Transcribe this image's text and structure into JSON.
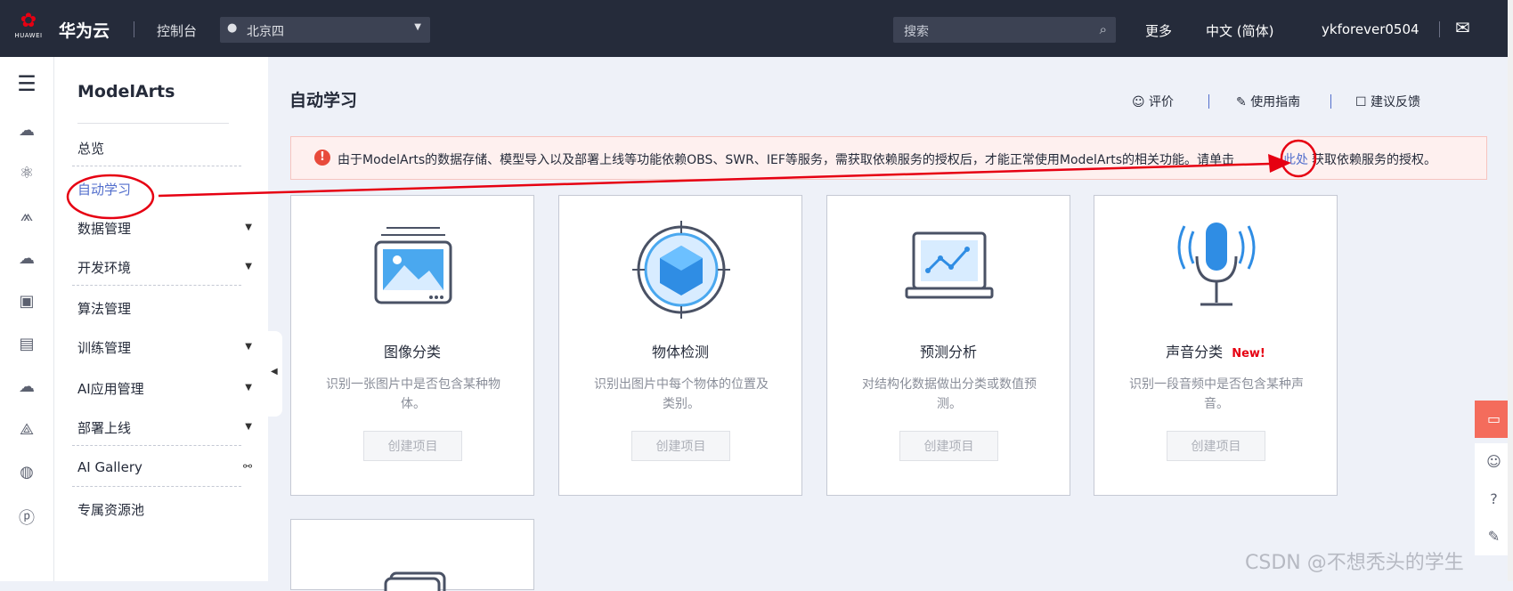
{
  "topbar": {
    "logo_text": "HUAWEI",
    "brand": "华为云",
    "console": "控制台",
    "region": "北京四",
    "search_placeholder": "搜索",
    "more": "更多",
    "language": "中文 (简体)",
    "username": "ykforever0504"
  },
  "sidebar": {
    "title": "ModelArts",
    "items": [
      {
        "label": "总览"
      },
      {
        "label": "自动学习"
      },
      {
        "label": "数据管理"
      },
      {
        "label": "开发环境"
      },
      {
        "label": "算法管理"
      },
      {
        "label": "训练管理"
      },
      {
        "label": "AI应用管理"
      },
      {
        "label": "部署上线"
      },
      {
        "label": "AI Gallery"
      },
      {
        "label": "专属资源池"
      }
    ]
  },
  "header": {
    "title": "自动学习",
    "rate": "评价",
    "guide": "使用指南",
    "feedback": "建议反馈"
  },
  "alert": {
    "text_before": "由于ModelArts的数据存储、模型导入以及部署上线等功能依赖OBS、SWR、IEF等服务，需获取依赖服务的授权后，才能正常使用ModelArts的相关功能。请单击",
    "link": "此处",
    "text_after": "获取依赖服务的授权。"
  },
  "cards": [
    {
      "title": "图像分类",
      "desc": "识别一张图片中是否包含某种物体。",
      "button": "创建项目",
      "badge": ""
    },
    {
      "title": "物体检测",
      "desc": "识别出图片中每个物体的位置及类别。",
      "button": "创建项目",
      "badge": ""
    },
    {
      "title": "预测分析",
      "desc": "对结构化数据做出分类或数值预测。",
      "button": "创建项目",
      "badge": ""
    },
    {
      "title": "声音分类",
      "desc": "识别一段音频中是否包含某种声音。",
      "button": "创建项目",
      "badge": "New!"
    }
  ],
  "watermark": "CSDN @不想秃头的学生",
  "colors": {
    "topbar": "#252b3a",
    "accent": "#526ecc",
    "annotation": "#e60012",
    "alert_bg": "#fef0ef"
  }
}
